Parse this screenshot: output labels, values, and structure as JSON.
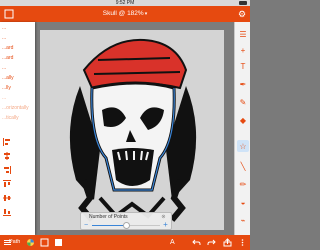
{
  "status": {
    "time": "9:52 PM"
  },
  "title": {
    "text": "Skull @ 182%",
    "caret": "▾"
  },
  "menu": {
    "items": [
      {
        "label": "...",
        "faded": false
      },
      {
        "label": "...",
        "faded": false
      },
      {
        "label": "...ard",
        "faded": false
      },
      {
        "label": "...ard",
        "faded": false
      },
      {
        "label": "...",
        "faded": false
      },
      {
        "label": "...ally",
        "faded": false
      },
      {
        "label": "...lly",
        "faded": false
      },
      {
        "label": "...",
        "faded": true
      },
      {
        "label": "...orizontally",
        "faded": true
      },
      {
        "label": "...tically",
        "faded": true
      }
    ],
    "icon_rows": [
      "align-left-icon",
      "align-center-icon",
      "align-right-icon",
      "align-top-icon",
      "align-middle-icon",
      "align-bottom-icon"
    ]
  },
  "tools": [
    "layers-icon",
    "add-icon",
    "text-tool-icon",
    "pen-tool-icon",
    "brush-tool-icon",
    "shape-tool-icon",
    "star-tool-icon",
    "line-tool-icon",
    "pencil-tool-icon",
    "fill-tool-icon",
    "eyedropper-tool-icon"
  ],
  "points_panel": {
    "label": "Number of Points",
    "value_fraction": 0.5,
    "minus": "−",
    "plus": "+",
    "clear": "⊗"
  },
  "bottombar": {
    "path_label": "Path",
    "tool_letter": "A"
  },
  "colors": {
    "accent": "#e64a10",
    "bandana": "#d9322a",
    "outline_blue": "#3a85d8"
  }
}
